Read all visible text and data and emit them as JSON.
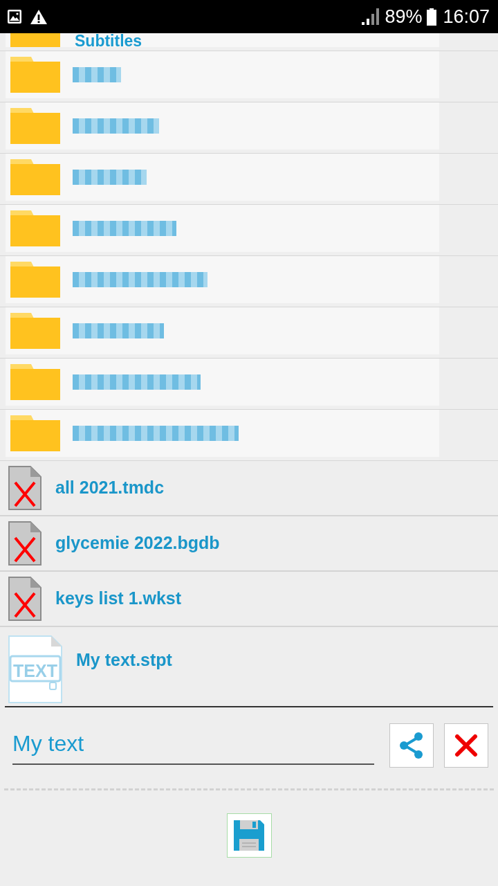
{
  "status_bar": {
    "battery": "89%",
    "time": "16:07"
  },
  "folders": [
    {
      "label": "Subtitles",
      "blurred": false
    },
    {
      "blurred": true
    },
    {
      "blurred": true
    },
    {
      "blurred": true
    },
    {
      "blurred": true
    },
    {
      "blurred": true
    },
    {
      "blurred": true
    },
    {
      "blurred": true
    },
    {
      "blurred": true
    }
  ],
  "files": [
    {
      "label": "all 2021.tmdc",
      "kind": "broken"
    },
    {
      "label": "glycemie 2022.bgdb",
      "kind": "broken"
    },
    {
      "label": "keys list 1.wkst",
      "kind": "broken"
    },
    {
      "label": "My text.stpt",
      "kind": "text",
      "icon_text": "TEXT"
    }
  ],
  "editor": {
    "value": "My text"
  }
}
